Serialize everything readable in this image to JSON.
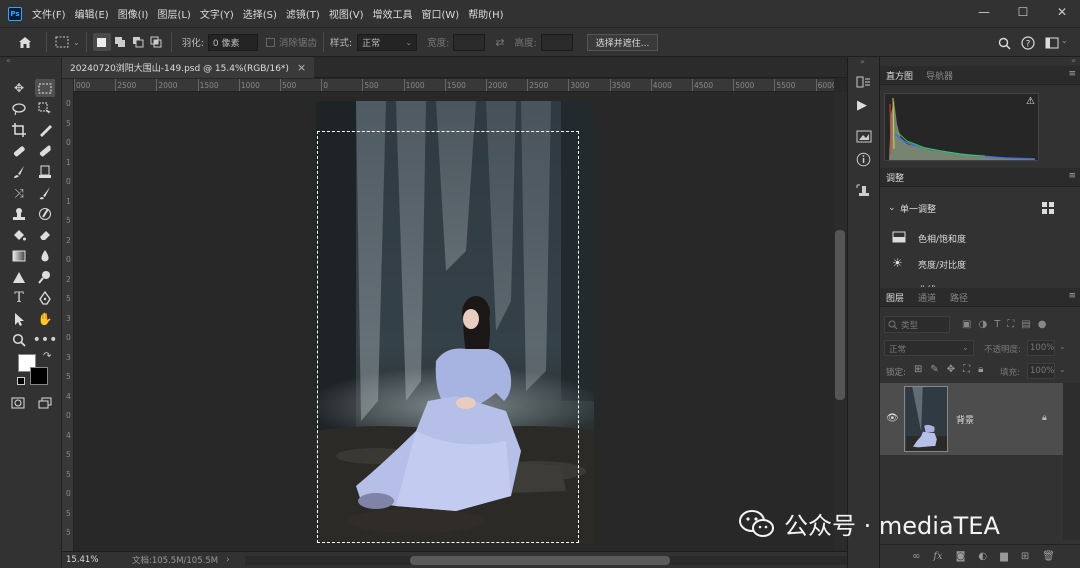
{
  "app": {
    "logo": "Ps"
  },
  "menu": [
    "文件(F)",
    "编辑(E)",
    "图像(I)",
    "图层(L)",
    "文字(Y)",
    "选择(S)",
    "滤镜(T)",
    "视图(V)",
    "增效工具",
    "窗口(W)",
    "帮助(H)"
  ],
  "window_controls": {
    "minimize": "—",
    "maximize": "☐",
    "close": "✕"
  },
  "options": {
    "feather_label": "羽化:",
    "feather_value": "0 像素",
    "antialias_label": "消除锯齿",
    "style_label": "样式:",
    "style_value": "正常",
    "width_label": "宽度:",
    "height_label": "高度:",
    "select_mask_button": "选择并遮住..."
  },
  "document": {
    "tab_title": "20240720浏阳大围山-149.psd @ 15.4%(RGB/16*)",
    "tab_close": "×",
    "zoom": "15.41%",
    "doc_size": "文档:105.5M/105.5M"
  },
  "ruler": {
    "h_ticks": [
      "000",
      "2500",
      "2000",
      "1500",
      "1000",
      "500",
      "0",
      "500",
      "1000",
      "1500",
      "2000",
      "2500",
      "3000",
      "3500",
      "4000",
      "4500",
      "5000",
      "5500",
      "6000"
    ],
    "v_ticks": [
      "0",
      "5",
      "0",
      "1",
      "0",
      "1",
      "5",
      "2",
      "0",
      "2",
      "5",
      "3",
      "0",
      "3",
      "5",
      "4",
      "0",
      "4",
      "5",
      "5",
      "0",
      "5",
      "5"
    ]
  },
  "panels": {
    "histogram_tab": "直方图",
    "navigator_tab": "导航器",
    "adjustments_tab": "调整",
    "single_adjust": "单一调整",
    "adjust_items": [
      "色相/饱和度",
      "亮度/对比度",
      "曲线"
    ],
    "layers_tab": "图层",
    "channels_tab": "通道",
    "paths_tab": "路径",
    "filter_kind": "类型",
    "blend_mode": "正常",
    "opacity_label": "不透明度:",
    "opacity_value": "100%",
    "lock_label": "锁定:",
    "fill_label": "填充:",
    "fill_value": "100%",
    "layer_name": "背景"
  },
  "watermark": {
    "text": "公众号 · mediaTEA"
  }
}
